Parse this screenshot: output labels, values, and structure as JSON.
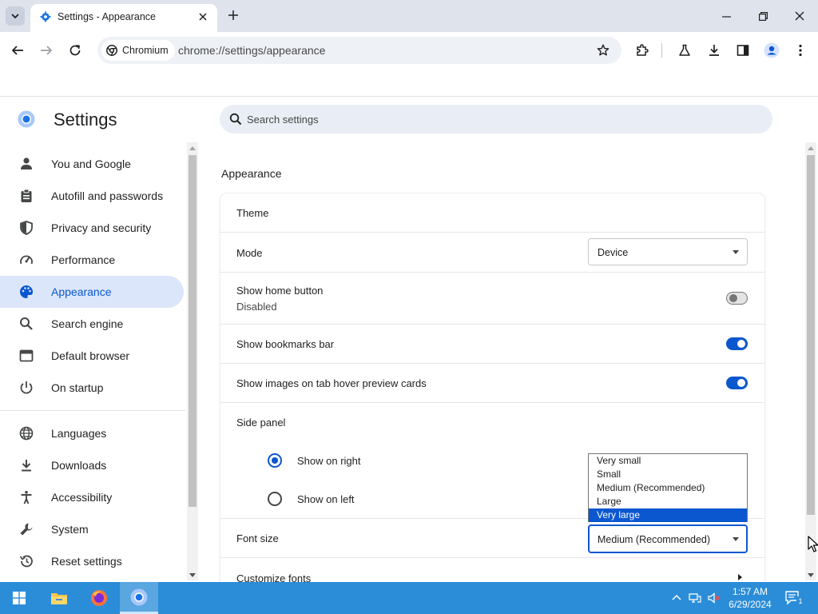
{
  "browser": {
    "tab_title": "Settings - Appearance",
    "chip_label": "Chromium",
    "url": "chrome://settings/appearance"
  },
  "settings": {
    "title": "Settings",
    "search_placeholder": "Search settings"
  },
  "sidebar": {
    "items": [
      {
        "label": "You and Google",
        "icon": "person-icon"
      },
      {
        "label": "Autofill and passwords",
        "icon": "clipboard-icon"
      },
      {
        "label": "Privacy and security",
        "icon": "shield-icon"
      },
      {
        "label": "Performance",
        "icon": "speedometer-icon"
      },
      {
        "label": "Appearance",
        "icon": "palette-icon",
        "active": true
      },
      {
        "label": "Search engine",
        "icon": "search-icon"
      },
      {
        "label": "Default browser",
        "icon": "browser-window-icon"
      },
      {
        "label": "On startup",
        "icon": "power-icon"
      },
      {
        "label": "Languages",
        "icon": "globe-icon"
      },
      {
        "label": "Downloads",
        "icon": "download-icon"
      },
      {
        "label": "Accessibility",
        "icon": "accessibility-icon"
      },
      {
        "label": "System",
        "icon": "wrench-icon"
      },
      {
        "label": "Reset settings",
        "icon": "history-icon"
      }
    ]
  },
  "appearance": {
    "section_title": "Appearance",
    "theme_label": "Theme",
    "mode_label": "Mode",
    "mode_value": "Device",
    "home_button_label": "Show home button",
    "home_button_sub": "Disabled",
    "home_button_on": false,
    "bookmarks_bar_label": "Show bookmarks bar",
    "bookmarks_bar_on": true,
    "hover_images_label": "Show images on tab hover preview cards",
    "hover_images_on": true,
    "side_panel_label": "Side panel",
    "side_panel_right": "Show on right",
    "side_panel_left": "Show on left",
    "side_panel_selected": "right",
    "font_size_label": "Font size",
    "font_size_value": "Medium (Recommended)",
    "customize_fonts_label": "Customize fonts"
  },
  "font_dropdown": {
    "options": [
      "Very small",
      "Small",
      "Medium (Recommended)",
      "Large",
      "Very large"
    ],
    "highlighted": "Very large"
  },
  "taskbar": {
    "time": "1:57 AM",
    "date": "6/29/2024",
    "notification_count": "1"
  },
  "colors": {
    "accent": "#0b57d0",
    "active_nav_bg": "#dbe6fa",
    "taskbar": "#2b8dd8"
  }
}
